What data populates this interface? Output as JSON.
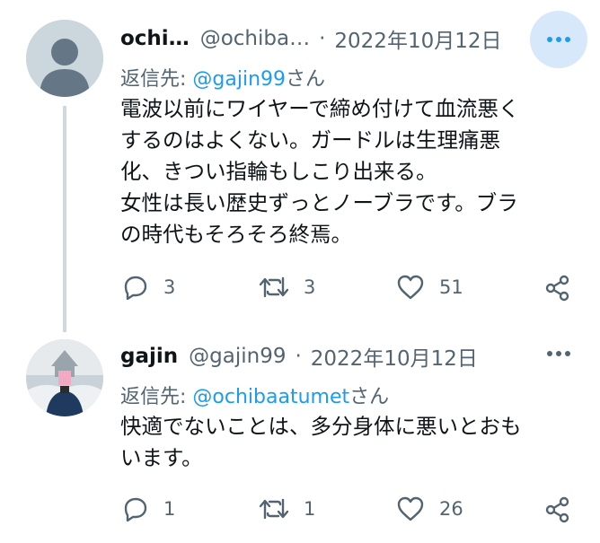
{
  "tweets": [
    {
      "display_name": "ochi…",
      "handle": "@ochiba…",
      "separator": "·",
      "date": "2022年10月12日",
      "replying_prefix": "返信先: ",
      "replying_to": "@gajin99",
      "replying_suffix": "さん",
      "body_lines": [
        "電波以前にワイヤーで締め付けて血流悪く",
        "するのはよくない。ガードルは生理痛悪",
        "化、きつい指輪もしこり出来る。",
        "女性は長い歴史ずっとノーブラです。ブラ",
        "の時代もそろそろ終焉。"
      ],
      "replies": "3",
      "retweets": "3",
      "likes": "51",
      "avatar_icon": "default-user-icon"
    },
    {
      "display_name": "gajin",
      "handle": "@gajin99",
      "separator": "·",
      "date": "2022年10月12日",
      "replying_prefix": "返信先: ",
      "replying_to": "@ochibaatumet",
      "replying_suffix": "さん",
      "body_lines": [
        "快適でないことは、多分身体に悪いとおも",
        "います。"
      ],
      "replies": "1",
      "retweets": "1",
      "likes": "26",
      "avatar_icon": "photo-avatar"
    }
  ],
  "colors": {
    "accent": "#1d9bf0",
    "secondary_text": "#536471",
    "primary_text": "#0f1419",
    "more_button_highlight": "#d7e8fb"
  }
}
